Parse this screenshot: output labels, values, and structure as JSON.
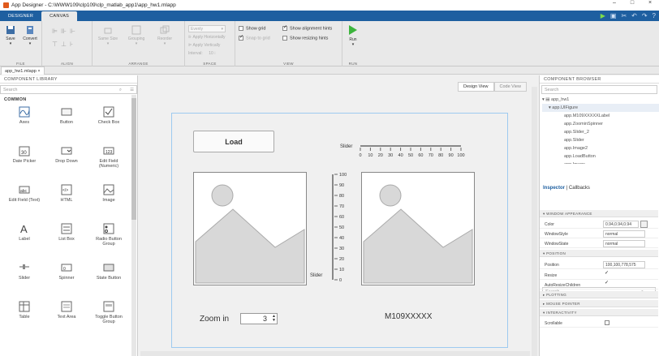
{
  "title_bar": {
    "text": "App Designer - C:\\WWW109\\clp109\\clp_matlab_app1\\app_hw1.mlapp"
  },
  "toolstrip_tabs": [
    "DESIGNER",
    "CANVAS"
  ],
  "ribbon": {
    "file": {
      "save": "Save",
      "convert": "Convert",
      "label": "FILE"
    },
    "align": {
      "label": "ALIGN"
    },
    "arrange": {
      "same_size": "Same Size",
      "grouping": "Grouping",
      "reorder": "Reorder",
      "label": "ARRANGE"
    },
    "space": {
      "evenly": "Evenly",
      "apply_horizontally": "Apply Horizontally",
      "apply_vertically": "Apply Vertically",
      "interval": "Interval:",
      "interval_value": "10",
      "label": "SPACE"
    },
    "view": {
      "show_grid": "Show grid",
      "snap_to_grid": "Snap to grid",
      "show_alignment_hints": "Show alignment hints",
      "show_resizing_hints": "Show resizing hints",
      "label": "VIEW",
      "show_grid_checked": false,
      "snap_checked": true,
      "alignment_checked": true,
      "resizing_checked": false
    },
    "run": {
      "run": "Run",
      "label": "RUN"
    }
  },
  "file_tab": "app_hw1.mlapp",
  "library": {
    "header": "COMPONENT LIBRARY",
    "search_placeholder": "Search",
    "section": "COMMON",
    "components": [
      {
        "label": "Axes",
        "icon": "axes-icon"
      },
      {
        "label": "Button",
        "icon": "button-icon"
      },
      {
        "label": "Check Box",
        "icon": "checkbox-icon"
      },
      {
        "label": "Date Picker",
        "icon": "date-picker-icon"
      },
      {
        "label": "Drop Down",
        "icon": "dropdown-icon"
      },
      {
        "label": "Edit Field (Numeric)",
        "icon": "numeric-field-icon"
      },
      {
        "label": "Edit Field (Text)",
        "icon": "text-field-icon"
      },
      {
        "label": "HTML",
        "icon": "html-icon"
      },
      {
        "label": "Image",
        "icon": "image-icon"
      },
      {
        "label": "Label",
        "icon": "label-icon"
      },
      {
        "label": "List Box",
        "icon": "listbox-icon"
      },
      {
        "label": "Radio Button Group",
        "icon": "radio-group-icon"
      },
      {
        "label": "Slider",
        "icon": "slider-icon"
      },
      {
        "label": "Spinner",
        "icon": "spinner-icon"
      },
      {
        "label": "State Button",
        "icon": "state-button-icon"
      },
      {
        "label": "Table",
        "icon": "table-icon"
      },
      {
        "label": "Text Area",
        "icon": "text-area-icon"
      },
      {
        "label": "Toggle Button Group",
        "icon": "toggle-group-icon"
      }
    ]
  },
  "canvas": {
    "design_view": "Design View",
    "code_view": "Code View",
    "load_button": "Load",
    "slider_label": "Slider",
    "h_slider_ticks": [
      "0",
      "10",
      "20",
      "30",
      "40",
      "50",
      "60",
      "70",
      "80",
      "90",
      "100"
    ],
    "vslider_label": "Slider",
    "v_slider_ticks": [
      "100",
      "90",
      "80",
      "70",
      "60",
      "50",
      "40",
      "30",
      "20",
      "10",
      "0"
    ],
    "zoom_label": "Zoom in",
    "zoom_value": "3",
    "id_label": "M109XXXXX"
  },
  "browser": {
    "header": "COMPONENT BROWSER",
    "search_placeholder": "Search",
    "tree": [
      "app_hw1",
      "app.UIFigure",
      "app.M109XXXXXLabel",
      "app.ZoominSpinner",
      "app.Slider_2",
      "app.Slider",
      "app.Image2",
      "app.LoadButton",
      "app.Image"
    ],
    "inspector_tab": "Inspector",
    "callbacks_tab": "Callbacks",
    "insp_search": "Search",
    "groups": {
      "window_appearance": "WINDOW APPEARANCE",
      "position": "POSITION",
      "plotting": "PLOTTING",
      "mouse_pointer": "MOUSE POINTER",
      "interactivity": "INTERACTIVITY"
    },
    "props": {
      "color": {
        "k": "Color",
        "v": "0.94,0.94,0.94"
      },
      "window_style": {
        "k": "WindowStyle",
        "v": "normal"
      },
      "window_state": {
        "k": "WindowState",
        "v": "normal"
      },
      "position": {
        "k": "Position",
        "v": "100,100,778,575"
      },
      "resize": {
        "k": "Resize"
      },
      "auto_resize": {
        "k": "AutoResizeChildren"
      },
      "scrollable": {
        "k": "Scrollable"
      }
    }
  }
}
